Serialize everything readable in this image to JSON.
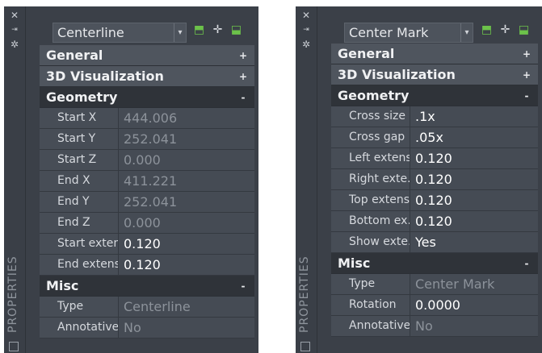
{
  "left_palette": {
    "title_strip": "PROPERTIES",
    "selector": "Centerline",
    "sections": [
      {
        "label": "General",
        "toggle": "+",
        "expanded": false
      },
      {
        "label": "3D Visualization",
        "toggle": "+",
        "expanded": false
      },
      {
        "label": "Geometry",
        "toggle": "-",
        "expanded": true,
        "rows": [
          {
            "key": "Start X",
            "value": "444.006",
            "readonly": true
          },
          {
            "key": "Start Y",
            "value": "252.041",
            "readonly": true
          },
          {
            "key": "Start Z",
            "value": "0.000",
            "readonly": true
          },
          {
            "key": "End X",
            "value": "411.221",
            "readonly": true
          },
          {
            "key": "End Y",
            "value": "252.041",
            "readonly": true
          },
          {
            "key": "End Z",
            "value": "0.000",
            "readonly": true
          },
          {
            "key": "Start exten...",
            "value": "0.120",
            "readonly": false
          },
          {
            "key": "End extens...",
            "value": "0.120",
            "readonly": false
          }
        ]
      },
      {
        "label": "Misc",
        "toggle": "-",
        "expanded": true,
        "rows": [
          {
            "key": "Type",
            "value": "Centerline",
            "readonly": true
          },
          {
            "key": "Annotative",
            "value": "No",
            "readonly": true
          }
        ]
      }
    ]
  },
  "right_palette": {
    "title_strip": "PROPERTIES",
    "selector": "Center Mark",
    "sections": [
      {
        "label": "General",
        "toggle": "+",
        "expanded": false
      },
      {
        "label": "3D Visualization",
        "toggle": "+",
        "expanded": false
      },
      {
        "label": "Geometry",
        "toggle": "-",
        "expanded": true,
        "rows": [
          {
            "key": "Cross size",
            "value": ".1x",
            "readonly": false
          },
          {
            "key": "Cross gap",
            "value": ".05x",
            "readonly": false
          },
          {
            "key": "Left extens...",
            "value": "0.120",
            "readonly": false
          },
          {
            "key": "Right exte...",
            "value": "0.120",
            "readonly": false
          },
          {
            "key": "Top extens...",
            "value": "0.120",
            "readonly": false
          },
          {
            "key": "Bottom ex...",
            "value": "0.120",
            "readonly": false
          },
          {
            "key": "Show exte...",
            "value": "Yes",
            "readonly": false
          }
        ]
      },
      {
        "label": "Misc",
        "toggle": "-",
        "expanded": true,
        "rows": [
          {
            "key": "Type",
            "value": "Center Mark",
            "readonly": true
          },
          {
            "key": "Rotation",
            "value": "0.0000",
            "readonly": false
          },
          {
            "key": "Annotative",
            "value": "No",
            "readonly": true
          }
        ]
      }
    ]
  },
  "icons": {
    "close": "close-icon",
    "autohide": "autohide-icon",
    "settings": "settings-icon",
    "quick_select": "quick-select-icon",
    "select_objects": "select-objects-icon",
    "pickadd": "pickadd-toggle-icon"
  }
}
